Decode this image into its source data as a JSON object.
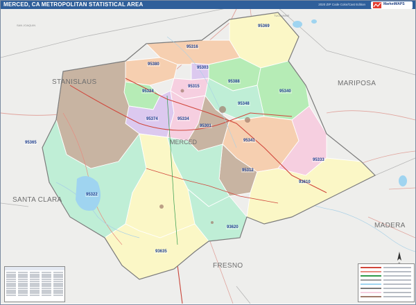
{
  "header": {
    "title": "MERCED, CA METROPOLITAN STATISTICAL AREA",
    "edition": "2020 ZIP Code Color/Cast Edition",
    "logo_text": "MarketMAPS"
  },
  "counties": {
    "stanislaus": "STANISLAUS",
    "mariposa": "MARIPOSA",
    "merced": "MERCED",
    "santa_clara": "SANTA CLARA",
    "madera": "MADERA",
    "fresno": "FRESNO",
    "san_joaquin": "SAN JOAQUIN",
    "tuolumne": "TUOLUMNE"
  },
  "zip_codes": {
    "z95369": "95369",
    "z95316": "95316",
    "z95380": "95380",
    "z95303": "95303",
    "z95388": "95388",
    "z95324": "95324",
    "z95315": "95315",
    "z95340": "95340",
    "z95348": "95348",
    "z95374": "95374",
    "z95334": "95334",
    "z95301": "95301",
    "z95341": "95341",
    "z95365": "95365",
    "z95333": "95333",
    "z95312": "95312",
    "z93610": "93610",
    "z95322": "95322",
    "z93620": "93620",
    "z93635": "93635"
  },
  "colors": {
    "title_bar": "#2f5f9a",
    "pink": "#f6cfe0",
    "mint": "#bfeed6",
    "lavender": "#dcc9ef",
    "tan": "#c8b4a2",
    "peach": "#f6cfb0",
    "yellow": "#fbf7c6",
    "cream": "#f6efd3",
    "green": "#b6ecb6",
    "road": "#d0453a",
    "water": "#9fd4f0"
  }
}
